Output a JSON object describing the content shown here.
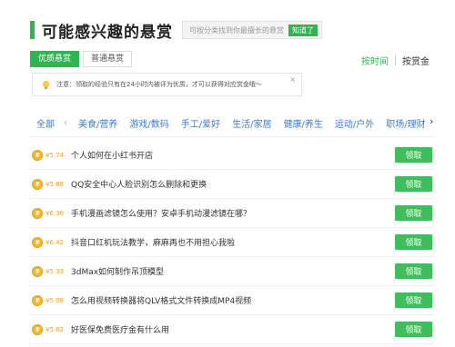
{
  "header": {
    "title": "可能感兴趣的悬赏",
    "hint": "可按分类找到你最擅长的悬赏",
    "hint_button": "知道了"
  },
  "tabs": [
    {
      "label": "优质悬赏",
      "active": true
    },
    {
      "label": "普通悬赏",
      "active": false
    }
  ],
  "sort": {
    "by_time": "按时间",
    "by_reward": "按赏金"
  },
  "notice": {
    "text": "注意：领取的经验只有在24小时内被评为优质，才可以获得对应赏金哦～",
    "close": "×"
  },
  "categories": {
    "all": "全部",
    "prev": "‹",
    "next": "›",
    "items": [
      "美食/营养",
      "游戏/数码",
      "手工/爱好",
      "生活/家居",
      "健康/养生",
      "运动/户外",
      "职场/理财"
    ]
  },
  "questions": [
    {
      "reward": "¥5.74",
      "title": "个人如何在小红书开店",
      "button": "领取"
    },
    {
      "reward": "¥5.88",
      "title": "QQ安全中心人脸识别怎么删除和更换",
      "button": "领取"
    },
    {
      "reward": "¥6.36",
      "title": "手机漫画滤镜怎么使用？安卓手机动漫滤镜在哪？",
      "button": "领取"
    },
    {
      "reward": "¥6.42",
      "title": "抖音口红机玩法教学，麻麻再也不用担心我啦",
      "button": "领取"
    },
    {
      "reward": "¥5.33",
      "title": "3dMax如何制作吊顶模型",
      "button": "领取"
    },
    {
      "reward": "¥5.08",
      "title": "怎么用视频转换器将QLV格式文件转换成MP4视频",
      "button": "领取"
    },
    {
      "reward": "¥5.62",
      "title": "好医保免费医疗金有什么用",
      "button": "领取"
    }
  ],
  "colors": {
    "accent": "#2fb550",
    "link": "#3a7bd5",
    "coin": "#f5b921",
    "reward_text": "#f0a020"
  }
}
